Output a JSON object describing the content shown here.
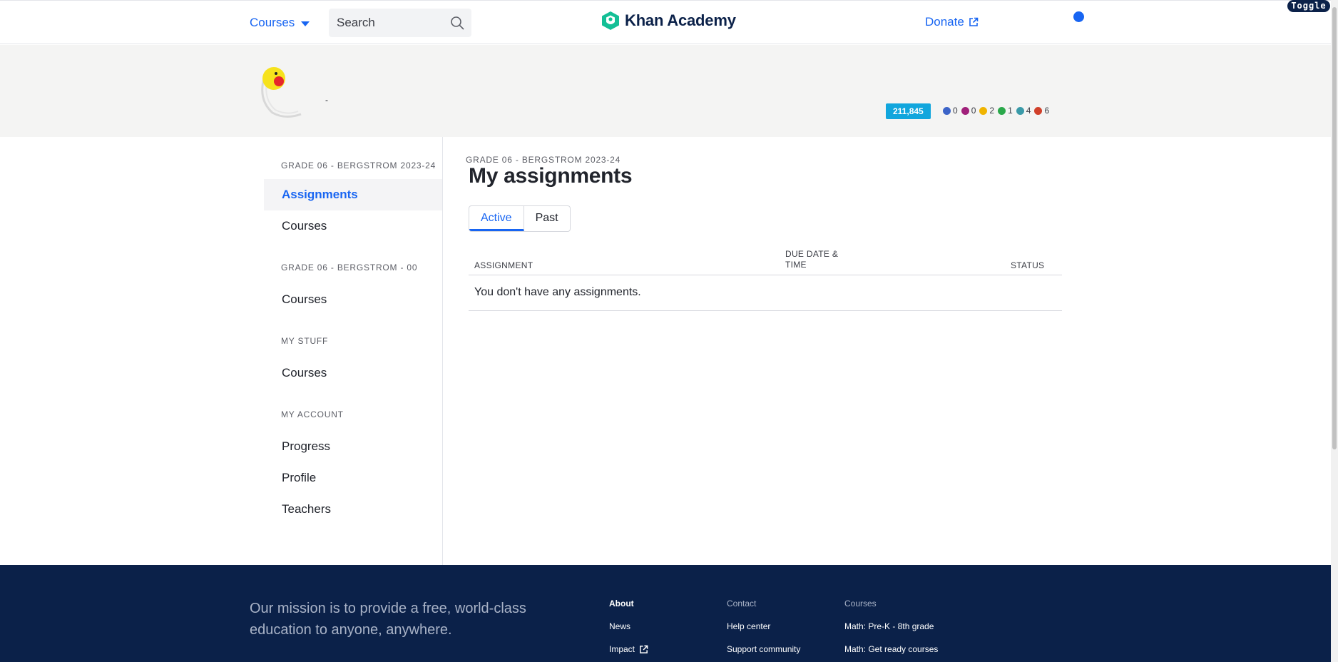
{
  "topnav": {
    "courses_label": "Courses",
    "search_placeholder": "Search",
    "logo_text": "Khan Academy",
    "donate_label": "Donate",
    "toggle_label": "Toggle",
    "brand_color": "#1865f2"
  },
  "profile": {
    "name_dash": "-",
    "points": "211,845",
    "badges": [
      {
        "icon": "challenge-patch-icon",
        "count": "0",
        "color": "#3c64c8"
      },
      {
        "icon": "black-hole-badge-icon",
        "count": "0",
        "color": "#a0207a"
      },
      {
        "icon": "sun-badge-icon",
        "count": "2",
        "color": "#f0b400"
      },
      {
        "icon": "earth-badge-icon",
        "count": "1",
        "color": "#2aa84a"
      },
      {
        "icon": "moon-badge-icon",
        "count": "4",
        "color": "#3a9aa8"
      },
      {
        "icon": "meteorite-badge-icon",
        "count": "6",
        "color": "#d0402a"
      }
    ]
  },
  "sidebar": {
    "sections": [
      {
        "label": "GRADE 06 - BERGSTROM 2023-24",
        "items": [
          "Assignments",
          "Courses"
        ]
      },
      {
        "label": "GRADE 06 - BERGSTROM - 00",
        "items": [
          "Courses"
        ]
      },
      {
        "label": "MY STUFF",
        "items": [
          "Courses"
        ]
      },
      {
        "label": "MY ACCOUNT",
        "items": [
          "Progress",
          "Profile",
          "Teachers"
        ]
      }
    ]
  },
  "main": {
    "breadcrumb": "GRADE 06 - BERGSTROM 2023-24",
    "title": "My assignments",
    "tabs": [
      "Active",
      "Past"
    ],
    "table": {
      "col_assignment": "ASSIGNMENT",
      "col_due": "DUE DATE & TIME",
      "col_status": "STATUS",
      "empty_message": "You don't have any assignments."
    }
  },
  "footer": {
    "mission": "Our mission is to provide a free, world-class education to anyone, anywhere.",
    "about": {
      "heading": "About",
      "links": [
        "News",
        "Impact"
      ]
    },
    "contact": {
      "heading": "Contact",
      "links": [
        "Help center",
        "Support community"
      ]
    },
    "courses": {
      "heading": "Courses",
      "links": [
        "Math: Pre-K - 8th grade",
        "Math: Get ready courses"
      ]
    }
  }
}
